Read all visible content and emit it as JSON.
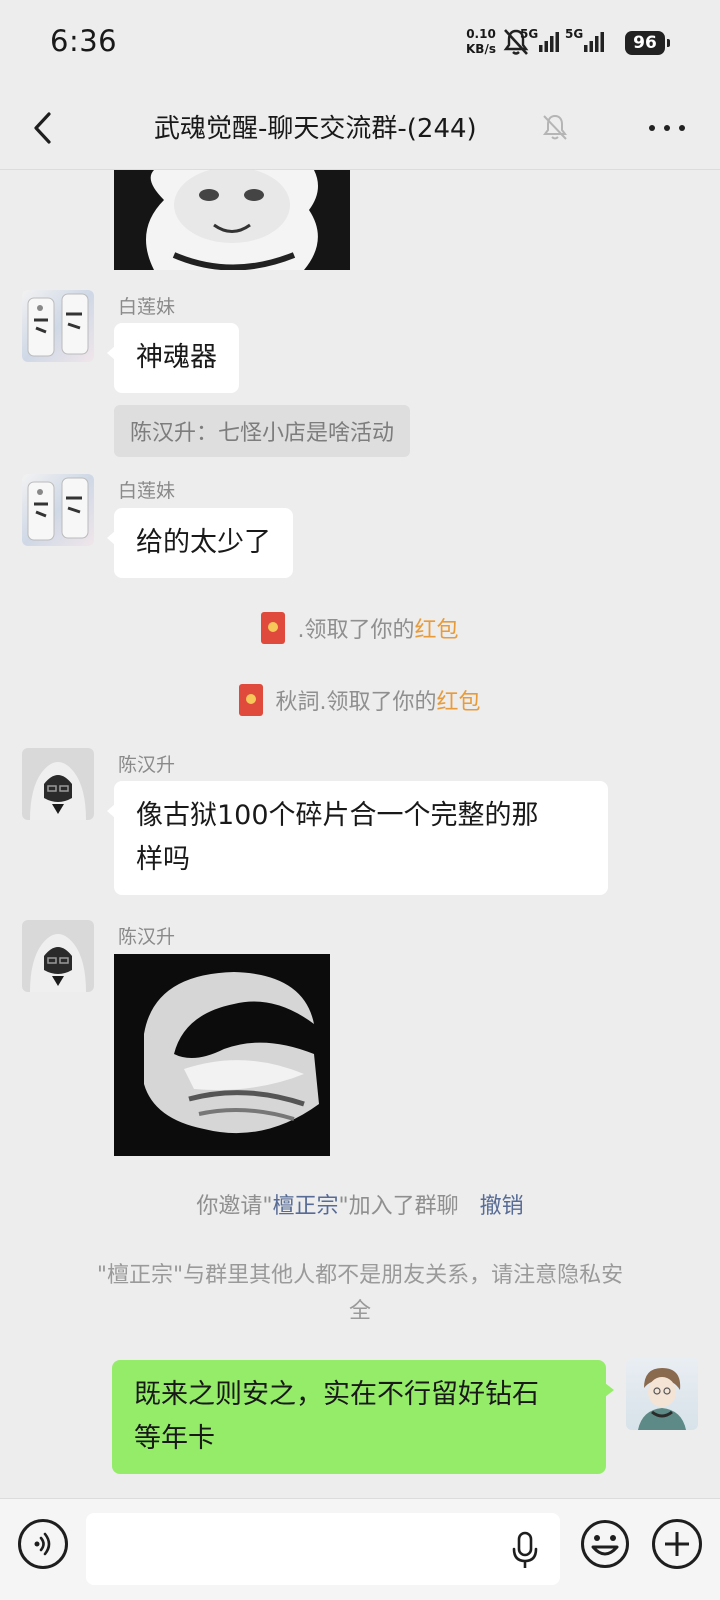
{
  "status_bar": {
    "time": "6:36",
    "net_speed_value": "0.10",
    "net_speed_unit": "KB/s",
    "sim1_type": "5G",
    "sim2_type": "5G",
    "battery": "96"
  },
  "header": {
    "title": "武魂觉醒-聊天交流群-(244)",
    "icons": [
      "back-arrow-icon",
      "mute-bell-icon",
      "more-icon"
    ]
  },
  "messages": [
    {
      "type": "sticker",
      "sender": "",
      "description": "panda-meme-sticker"
    },
    {
      "type": "text",
      "sender": "白莲妹",
      "text": "神魂器",
      "quote": "陈汉升：七怪小店是啥活动"
    },
    {
      "type": "text",
      "sender": "白莲妹",
      "text": "给的太少了"
    },
    {
      "type": "red-packet-notice",
      "prefix": ".领取了你的",
      "highlight": "红包"
    },
    {
      "type": "red-packet-notice",
      "prefix": "秋詞.领取了你的",
      "highlight": "红包"
    },
    {
      "type": "text",
      "sender": "陈汉升",
      "text_line1": "像古狱100个碎片合一个完整的那",
      "text_line2": "样吗"
    },
    {
      "type": "sticker",
      "sender": "陈汉升",
      "description": "panda-meme-sticker"
    },
    {
      "type": "invite-notice",
      "part1": "你邀请\"",
      "name": "檀正宗",
      "part2": "\"加入了群聊",
      "action": "撤销"
    },
    {
      "type": "privacy-notice",
      "line1": "\"檀正宗\"与群里其他人都不是朋友关系，请注意隐私安",
      "line2": "全"
    },
    {
      "type": "text",
      "sender": "me",
      "text_line1": "既来之则安之，实在不行留好钻石",
      "text_line2": "等年卡"
    }
  ],
  "input_bar": {
    "placeholder": "",
    "icons": [
      "voice-icon",
      "mic-icon",
      "emoji-icon",
      "plus-icon"
    ]
  },
  "colors": {
    "background": "#ededed",
    "my_bubble": "#95ec69",
    "other_bubble": "#ffffff",
    "red_packet_highlight": "#e89b3a",
    "link": "#576b95"
  }
}
